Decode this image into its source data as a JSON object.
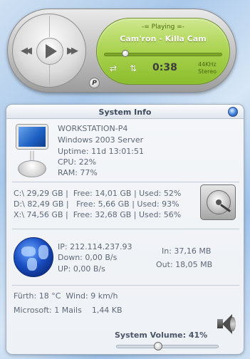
{
  "player": {
    "status": "-= Playing =-",
    "track": "Cam'ron - Killa Cam",
    "time": "0:38",
    "sample_rate": "44KHz",
    "channels": "Stereo",
    "badge": "P",
    "seek_fraction": 0.18
  },
  "panel": {
    "title": "System Info",
    "system": {
      "host": "WORKSTATION-P4",
      "os": "Windows 2003 Server",
      "uptime": "Uptime: 11d 13:01:51",
      "cpu": "CPU: 22%",
      "ram": "RAM: 77%"
    },
    "drives": [
      "C:\\ 29,29 GB |  Free: 14,01 GB | Used: 52%",
      "D:\\ 82,49 GB |   Free: 5,66 GB | Used: 93%",
      "X:\\ 74,56 GB |  Free: 32,68 GB | Used: 56%"
    ],
    "network": {
      "ip": "IP: 212.114.237.93",
      "down": "Down: 0,00 B/s",
      "up": "UP: 0,00 B/s",
      "in": "In: 37,16 MB",
      "out": "Out: 18,05 MB"
    },
    "weather": "Fürth: 18 °C  Wind: 9 km/h",
    "mail": "Microsoft: 1 Mails    1,44 KB",
    "volume_label": "System Volume: 41%",
    "volume_fraction": 0.41
  },
  "colors": {
    "lcd_green": "#a9d24f",
    "text_gray": "#5e6977",
    "title_dark": "#3e4a5c"
  }
}
